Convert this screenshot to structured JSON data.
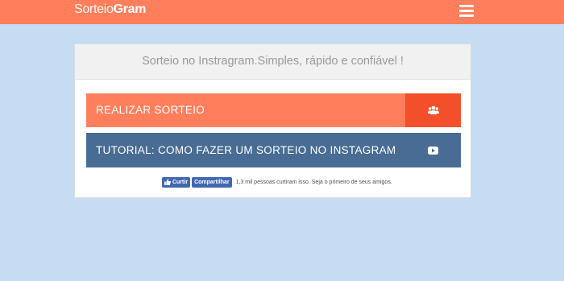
{
  "header": {
    "brand_light": "Sorteio",
    "brand_bold": "Gram"
  },
  "card": {
    "tagline": "Sorteio no Instragram.Simples, rápido e confiável !",
    "primary_button": {
      "label": "REALIZAR SORTEIO",
      "icon": "users-icon"
    },
    "tutorial_button": {
      "label": "TUTORIAL: COMO FAZER UM SORTEIO NO INSTAGRAM",
      "icon": "youtube-play-icon"
    }
  },
  "facebook": {
    "like_label": "Curtir",
    "share_label": "Compartilhar",
    "social_text": "1,3 mil pessoas curtiram isso. Seja o primeiro de seus amigos."
  },
  "colors": {
    "accent": "#ff7f5c",
    "accent_dark": "#f34f2a",
    "tutorial": "#486c93",
    "background": "#c5dcf2",
    "facebook": "#4267b2"
  }
}
